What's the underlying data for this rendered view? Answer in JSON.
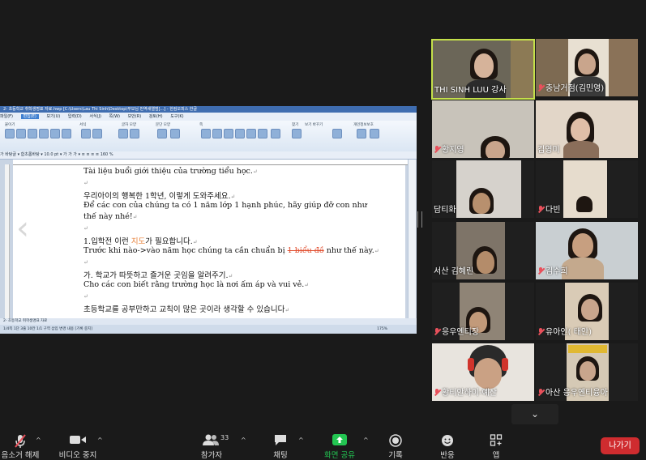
{
  "document": {
    "title": "2- 초등학교 취학생명표 자료.hwp [C:\\Users\\Lau Thi Sinh\\Desktop\\부모님 번역새앨범]...] - 한컴오피스 한글",
    "menus": [
      "파일(F)",
      "편집(E)",
      "보기(U)",
      "입력(D)",
      "서식(J)",
      "쪽(W)",
      "보안(R)",
      "검토(H)",
      "도구(K)"
    ],
    "active_menu": "편집(E)",
    "ribbon_groups": [
      "붙이기",
      "서식",
      "글자 모양",
      "문단 모양",
      "쪽",
      "찾기",
      "스타일",
      "표",
      "그림",
      "도형",
      "메모",
      "차트",
      "보기 바꾸기",
      "맞춤법",
      "개인정보보호",
      "검색"
    ],
    "format_bar": "가 바탕글   ▾  함초롬바탕 ▾  10.0 pt ▾  가 가 가 ▾  ≡ ≡ ≡ ≡  160 %",
    "lines": [
      {
        "text": "Tài liệu buổi giới thiệu của trường tiểu học.",
        "mark": "↵"
      },
      {
        "text": "",
        "mark": "↵"
      },
      {
        "text": "우리아이의 행복한 1학년, 이렇게 도와주세요.",
        "mark": "↵"
      },
      {
        "text": "Để các con của chúng ta có 1 năm lớp 1 hạnh phúc, hãy giúp đỡ con như",
        "mark": ""
      },
      {
        "text": "thế này nhé!",
        "mark": "↵"
      },
      {
        "text": "",
        "mark": "↵"
      },
      {
        "pre": "1.입학전 이런 ",
        "hl": "지도",
        "post": "가 필요합니다.",
        "mark": "↵"
      },
      {
        "pre": "Trước khi nào->vào năm học chúng ta cần chuẩn bị ",
        "strike": "1 biểu đồ",
        "post": " như thế này.",
        "mark": "↵"
      },
      {
        "text": "",
        "mark": "↵"
      },
      {
        "text": "가. 학교가 따뜻하고 즐거운 곳임을 알려주기.",
        "mark": "↵"
      },
      {
        "text": "Cho các con biết rằng trường học là nơi ấm áp và vui vẻ.",
        "mark": "↵"
      },
      {
        "text": "",
        "mark": "↵"
      },
      {
        "text": "초등학교를 공부만하고 교칙이 많은 곳이라 생각할 수 있습니다",
        "mark": "↵"
      }
    ],
    "tab": "2- 초등학교 취학생명표 자료",
    "status": "1/4쪽   1단   3줄   10칸   1/1 구역   삽입   변경 내용 [기록 중지]",
    "zoom": "175%"
  },
  "participants": [
    {
      "name": "THI SINH LUU 강사",
      "muted": false,
      "speaking": true
    },
    {
      "name": "충남거점(김민영)",
      "muted": true
    },
    {
      "name": "황지영",
      "muted": true
    },
    {
      "name": "김영미",
      "muted": false
    },
    {
      "name": "담티화",
      "muted": false
    },
    {
      "name": "다빈",
      "muted": true
    },
    {
      "name": "서산 김혜린",
      "muted": false
    },
    {
      "name": "김수희",
      "muted": true
    },
    {
      "name": "응우옌티장",
      "muted": true
    },
    {
      "name": "유아인( 태안)",
      "muted": true
    },
    {
      "name": "황티안하이-예산",
      "muted": true
    },
    {
      "name": "아산 응우옌티융아",
      "muted": true
    }
  ],
  "toolbar": {
    "mute": "음소거 해제",
    "video": "비디오 중지",
    "participants": "참가자",
    "participants_count": "33",
    "chat": "채팅",
    "share": "화면 공유",
    "record": "기록",
    "reactions": "반응",
    "apps": "앱",
    "leave": "나가기"
  },
  "colors": {
    "share_green": "#23c552",
    "leave_red": "#cf2c2f",
    "muted_red": "#e8505b",
    "speaker_border": "#c4e04a"
  }
}
